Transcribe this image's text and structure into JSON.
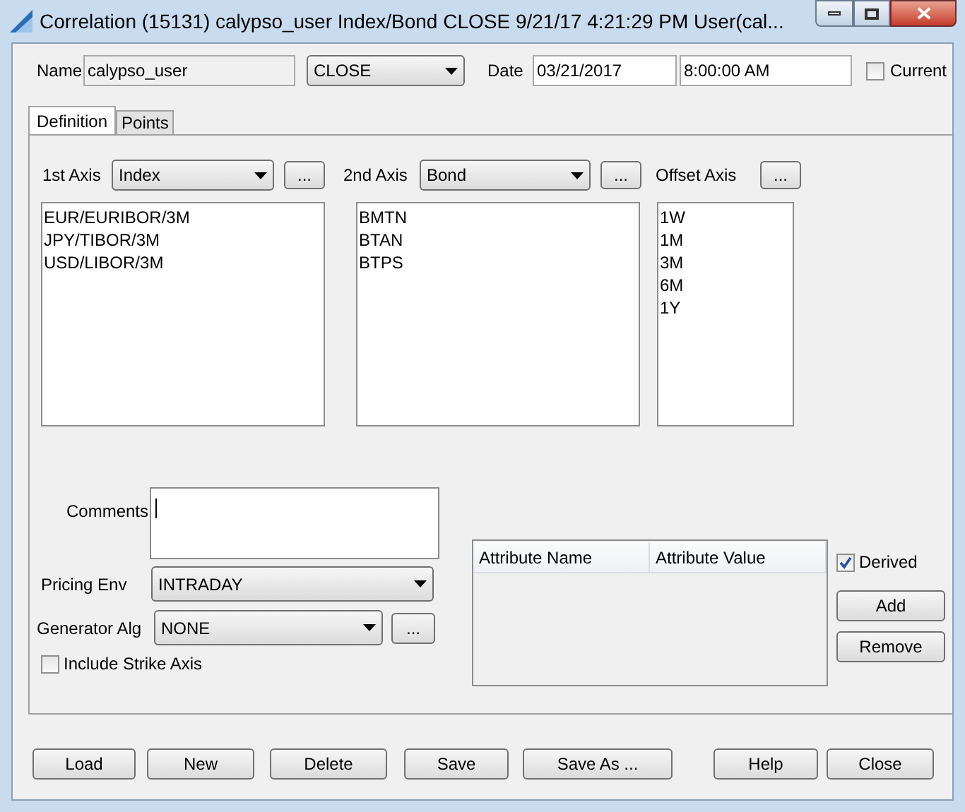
{
  "window": {
    "title": "Correlation (15131) calypso_user Index/Bond CLOSE 9/21/17 4:21:29 PM User(cal..."
  },
  "header": {
    "name_label": "Name",
    "name_value": "calypso_user",
    "set_value": "CLOSE",
    "date_label": "Date",
    "date_value": "03/21/2017",
    "time_value": "8:00:00 AM",
    "current_label": "Current",
    "current_checked": false
  },
  "tabs": [
    {
      "label": "Definition",
      "selected": true
    },
    {
      "label": "Points",
      "selected": false
    }
  ],
  "axes": {
    "first_label": "1st Axis",
    "first_value": "Index",
    "second_label": "2nd Axis",
    "second_value": "Bond",
    "offset_label": "Offset Axis",
    "more_button": "..."
  },
  "lists": [
    [
      "EUR/EURIBOR/3M",
      "JPY/TIBOR/3M",
      "USD/LIBOR/3M"
    ],
    [
      "BMTN",
      "BTAN",
      "BTPS"
    ],
    [
      "1W",
      "1M",
      "3M",
      "6M",
      "1Y"
    ]
  ],
  "comments_label": "Comments",
  "pricing_env": {
    "label": "Pricing Env",
    "value": "INTRADAY"
  },
  "generator_alg": {
    "label": "Generator Alg",
    "value": "NONE",
    "more_button": "..."
  },
  "include_strike_axis": {
    "label": "Include Strike Axis",
    "checked": false
  },
  "attributes": {
    "columns": [
      "Attribute Name",
      "Attribute Value"
    ]
  },
  "derived": {
    "label": "Derived",
    "checked": true
  },
  "attribute_buttons": [
    "Add",
    "Remove"
  ],
  "buttons": [
    "Load",
    "New",
    "Delete",
    "Save",
    "Save As ...",
    "Help",
    "Close"
  ]
}
